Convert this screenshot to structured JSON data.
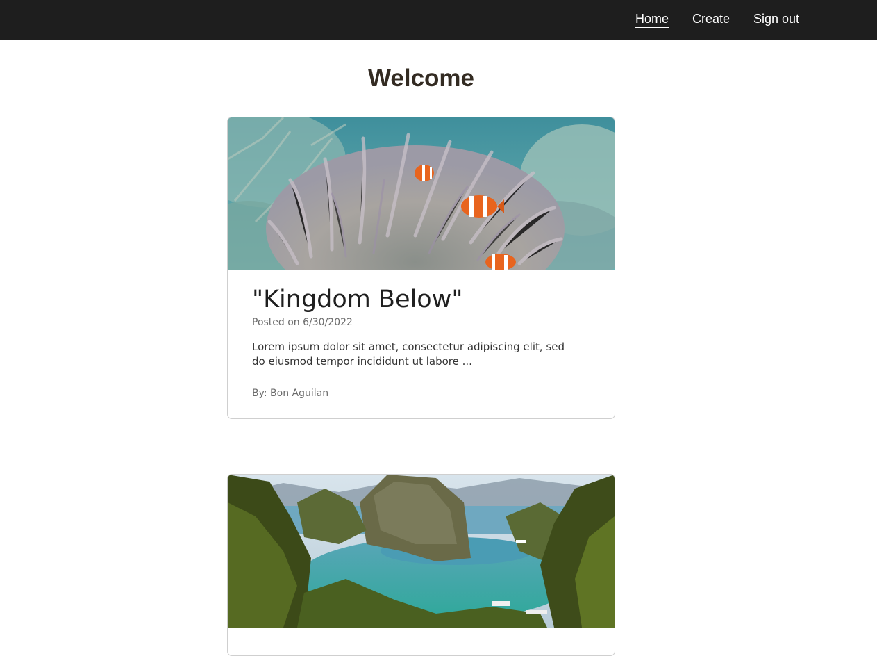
{
  "nav": {
    "home_label": "Home",
    "create_label": "Create",
    "signout_label": "Sign out"
  },
  "page": {
    "title": "Welcome"
  },
  "posts": [
    {
      "title": "\"Kingdom Below\"",
      "date": "Posted on 6/30/2022",
      "excerpt": "Lorem ipsum dolor sit amet, consectetur adipiscing elit, sed do eiusmod tempor incididunt ut labore ...",
      "author": "By: Bon Aguilan",
      "image": "clownfish-anemone-photo"
    },
    {
      "image": "tropical-lagoon-photo"
    }
  ],
  "colors": {
    "navbar_bg": "#1e1e1e",
    "title_text": "#332b22",
    "card_border": "#cfcfcf"
  }
}
